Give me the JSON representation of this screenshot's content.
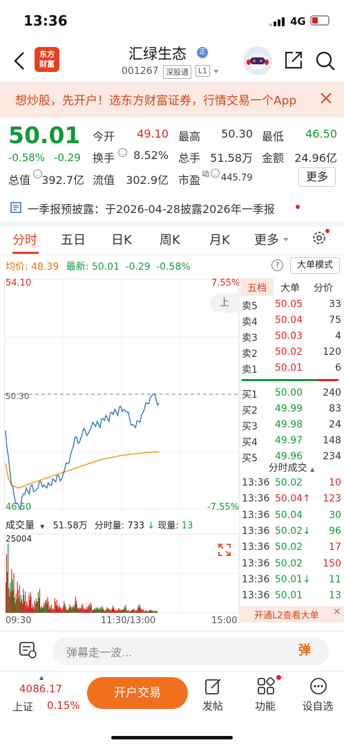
{
  "status_bar": {
    "time": "13:36",
    "network": "4G"
  },
  "header": {
    "logo_text_1": "东方",
    "logo_text_2": "财富",
    "stock_name": "汇绿生态",
    "badge": "正",
    "stock_code": "001267",
    "tags": [
      "深股通",
      "L1"
    ]
  },
  "banner": {
    "text": "想炒股，先开户！选东方财富证券，行情交易一个App"
  },
  "quote": {
    "price": "50.01",
    "change_pct": "-0.58%",
    "change": "-0.29",
    "fields": {
      "open_label": "今开",
      "open": "49.10",
      "high_label": "最高",
      "high": "50.30",
      "low_label": "最低",
      "low": "46.50",
      "turnover_label": "换手",
      "turnover": "8.52%",
      "volume_label": "总手",
      "volume": "51.58万",
      "amount_label": "金额",
      "amount": "24.96亿",
      "mktcap_label": "总值",
      "mktcap": "392.7亿",
      "float_label": "流值",
      "float": "302.9亿",
      "pe_label": "市盈",
      "pe_sup": "动",
      "pe": "445.79"
    },
    "more_label": "更多"
  },
  "disclosure": {
    "text": "一季报预披露：于2026-04-28披露2026年一季报"
  },
  "tabs": [
    "分时",
    "五日",
    "日K",
    "周K",
    "月K",
    "更多"
  ],
  "summary": {
    "avg_label": "均价:",
    "avg": "48.39",
    "latest_label": "最新:",
    "latest": "50.01",
    "latest_change": "-0.29",
    "latest_pct": "-0.58%",
    "big_order_label": "大单模式"
  },
  "chart_data": {
    "type": "line",
    "series": [
      {
        "name": "price",
        "values": [
          49.1,
          48.2,
          47.3,
          46.9,
          46.7,
          46.5,
          47.0,
          47.2,
          47.0,
          47.3,
          47.1,
          47.2,
          47.4,
          47.3,
          47.2,
          47.3,
          47.5,
          47.4,
          47.6,
          47.5,
          47.8,
          48.0,
          48.3,
          48.6,
          48.9,
          48.7,
          49.0,
          49.1,
          49.0,
          49.2,
          49.3,
          49.4,
          49.2,
          49.5,
          49.6,
          49.4,
          49.7,
          49.8,
          49.6,
          49.9,
          49.8,
          49.7,
          49.5,
          49.3,
          49.2,
          49.4,
          49.6,
          49.8,
          50.0,
          50.2,
          50.3,
          50.1,
          50.01
        ]
      },
      {
        "name": "avg",
        "values": [
          48.0,
          47.5,
          47.3,
          47.25,
          47.2,
          47.22,
          47.25,
          47.3,
          47.33,
          47.36,
          47.4,
          47.43,
          47.46,
          47.5,
          47.53,
          47.56,
          47.6,
          47.63,
          47.66,
          47.7,
          47.73,
          47.76,
          47.8,
          47.83,
          47.86,
          47.9,
          47.93,
          47.96,
          48.0,
          48.03,
          48.06,
          48.1,
          48.13,
          48.15,
          48.17,
          48.19,
          48.21,
          48.23,
          48.25,
          48.27,
          48.28,
          48.3,
          48.31,
          48.32,
          48.33,
          48.34,
          48.35,
          48.36,
          48.37,
          48.38,
          48.39,
          48.39,
          48.39
        ]
      }
    ],
    "ylim": [
      46.5,
      54.1
    ],
    "prev_close": "50.30",
    "y_top_label": "54.10",
    "y_bottom_label": "46.50",
    "pct_top": "7.55%",
    "pct_bottom": "-7.55%",
    "x_labels": [
      "09:30",
      "11:30/13:00",
      "15:00"
    ],
    "volume": {
      "title": "成交量",
      "total": "51.58万",
      "minute_label": "分时量:",
      "minute": "733",
      "now_label": "现量:",
      "now": "13",
      "ymax_label": "25004",
      "values": [
        25004,
        12000,
        15000,
        8000,
        11000,
        6000,
        9000,
        4000,
        7000,
        3000,
        5000,
        8000,
        2500,
        4000,
        6000,
        3000,
        2000,
        5000,
        3500,
        2000,
        4000,
        1500,
        3000,
        2500,
        6000,
        2000,
        3000,
        1800,
        2500,
        4000,
        1500,
        2200,
        1800,
        3000,
        1200,
        2000,
        1500,
        2500,
        1000,
        1800,
        1300,
        2600,
        1100,
        900,
        1600,
        1200,
        3500,
        1500,
        1000,
        800,
        1200,
        900,
        733
      ]
    }
  },
  "order_book": {
    "tabs": [
      "五档",
      "大单",
      "分价"
    ],
    "asks": [
      {
        "label": "卖5",
        "price": "50.05",
        "vol": "33"
      },
      {
        "label": "卖4",
        "price": "50.04",
        "vol": "75"
      },
      {
        "label": "卖3",
        "price": "50.03",
        "vol": "4"
      },
      {
        "label": "卖2",
        "price": "50.02",
        "vol": "120"
      },
      {
        "label": "卖1",
        "price": "50.01",
        "vol": "6"
      }
    ],
    "bids": [
      {
        "label": "买1",
        "price": "50.00",
        "vol": "240"
      },
      {
        "label": "买2",
        "price": "49.99",
        "vol": "83"
      },
      {
        "label": "买3",
        "price": "49.98",
        "vol": "24"
      },
      {
        "label": "买4",
        "price": "49.97",
        "vol": "148"
      },
      {
        "label": "买5",
        "price": "49.96",
        "vol": "234"
      }
    ],
    "trades_title": "分时成交",
    "trades": [
      {
        "time": "13:36",
        "price": "50.02",
        "vol": "10"
      },
      {
        "time": "13:36",
        "price": "50.04↑",
        "vol": "123"
      },
      {
        "time": "13:36",
        "price": "50.04",
        "vol": "30"
      },
      {
        "time": "13:36",
        "price": "50.02↓",
        "vol": "96"
      },
      {
        "time": "13:36",
        "price": "50.02",
        "vol": "17"
      },
      {
        "time": "13:36",
        "price": "50.02",
        "vol": "150"
      },
      {
        "time": "13:36",
        "price": "50.01↓",
        "vol": "11"
      },
      {
        "time": "13:36",
        "price": "50.01",
        "vol": "13"
      }
    ],
    "l2_text": "开通L2查看大单"
  },
  "danmaku": {
    "placeholder": "弹幕走一波...",
    "button": "弹"
  },
  "bottom_bar": {
    "index_value": "4086.17",
    "index_name": "上证",
    "index_pct": "0.15%",
    "trade_button": "开户交易",
    "items": [
      "发帖",
      "功能",
      "设自选"
    ]
  },
  "colors": {
    "up": "#e0201f",
    "down": "#0f9a35",
    "accent": "#f07020",
    "price_line": "#2f73c9",
    "avg_line": "#f0a020"
  }
}
